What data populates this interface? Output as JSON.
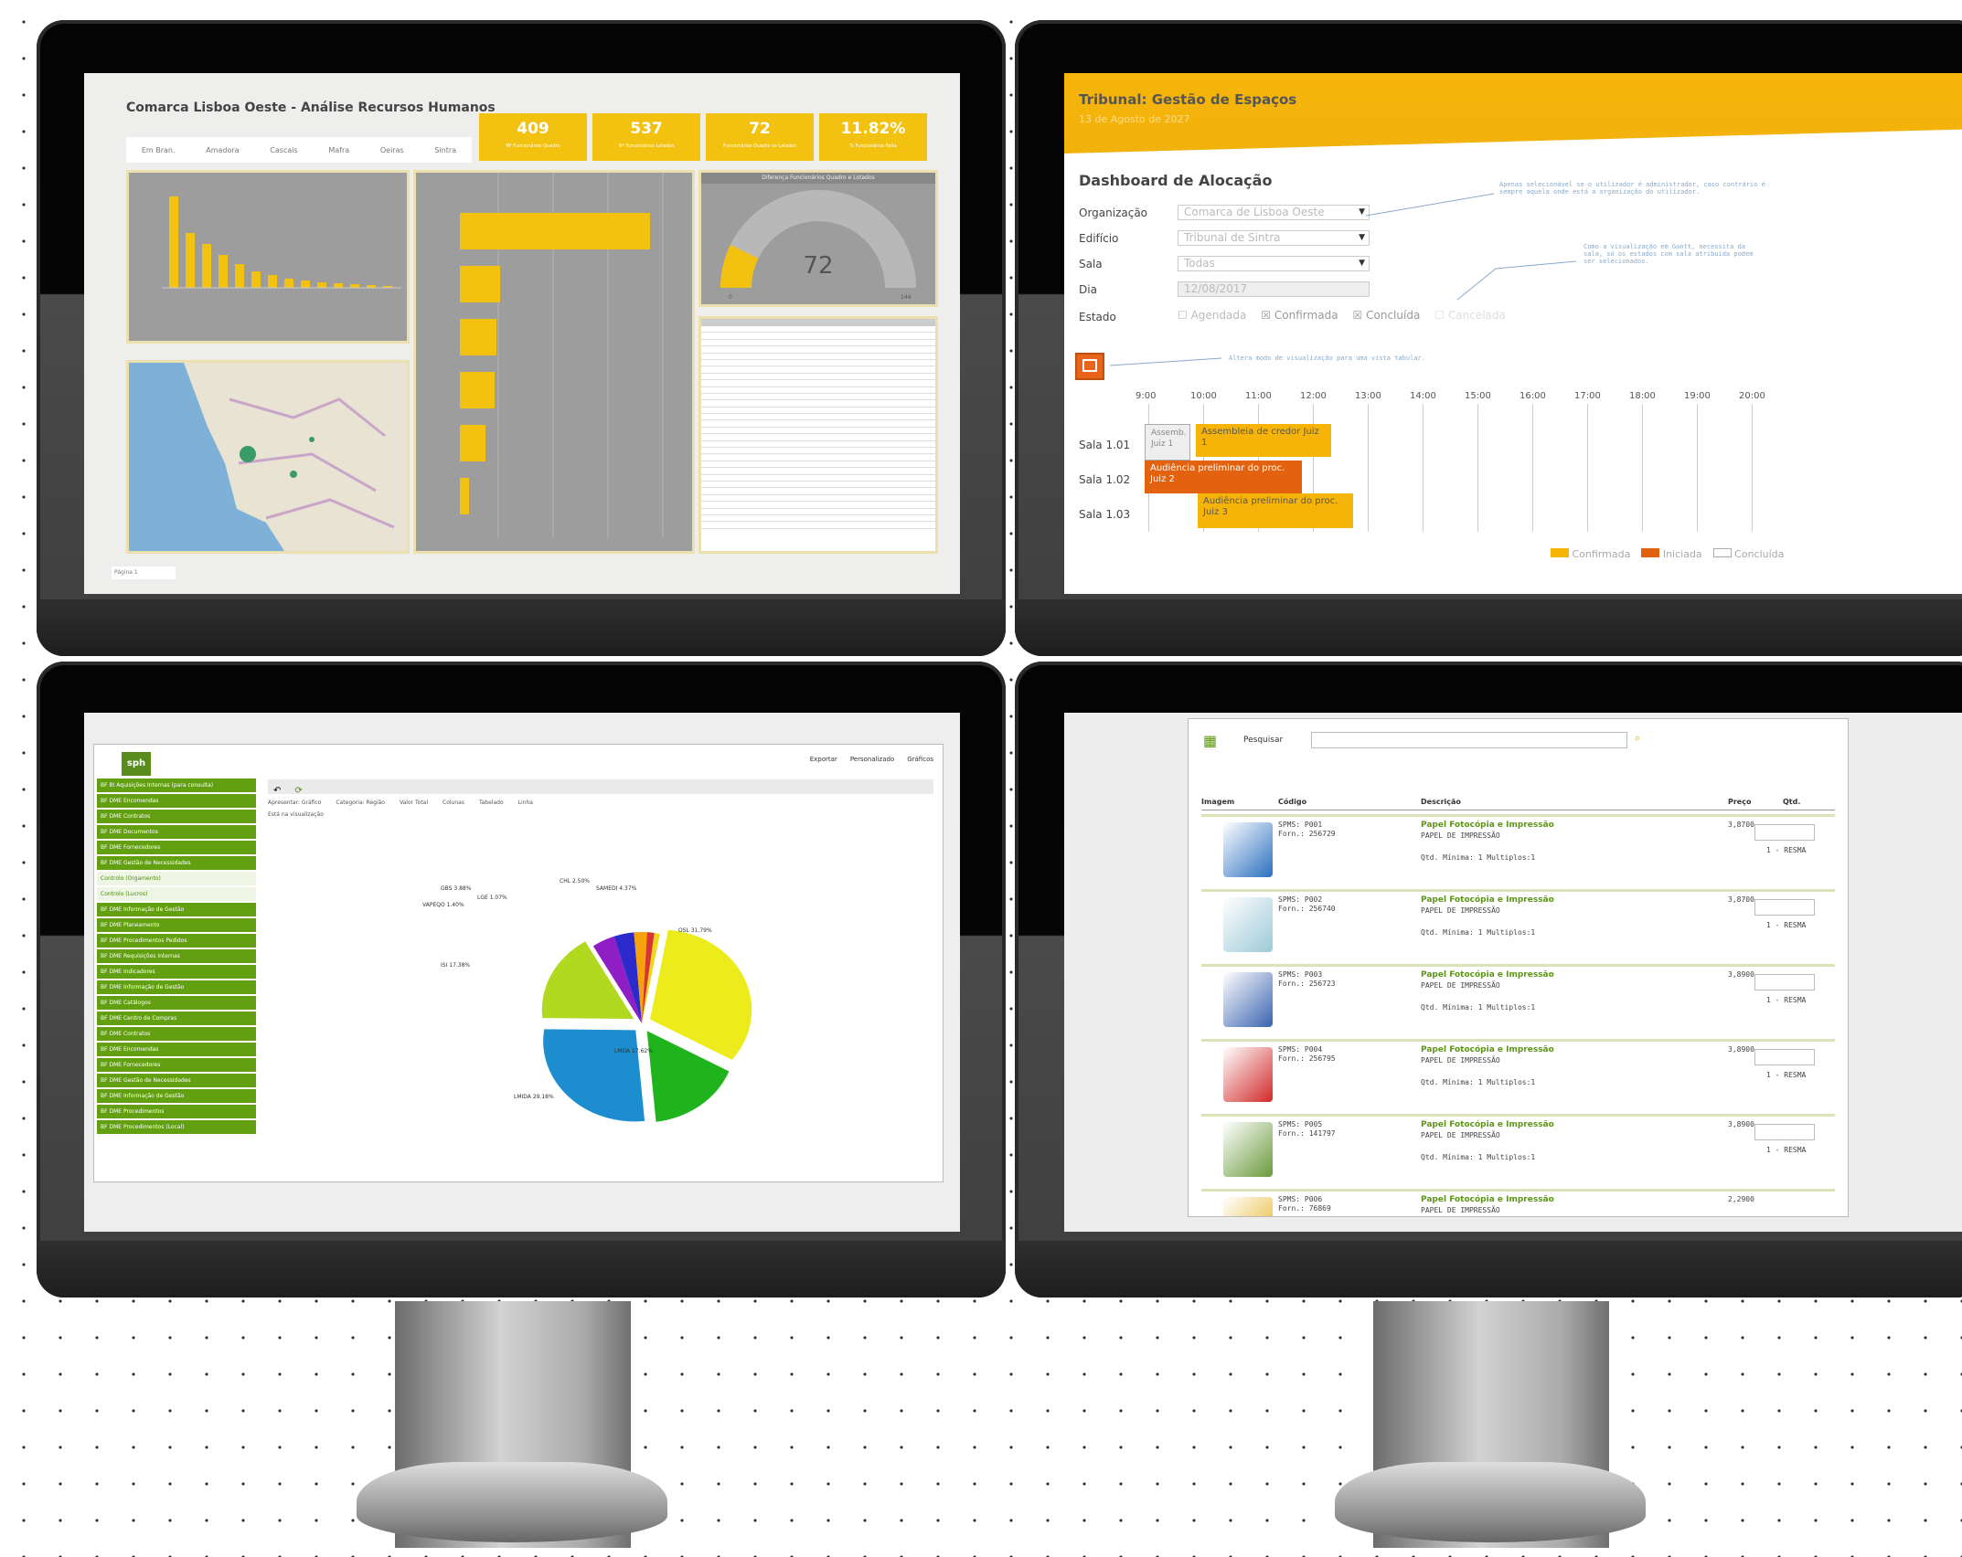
{
  "s1": {
    "title": "Comarca Lisboa Oeste - Análise Recursos Humanos",
    "tabs": [
      "Em Bran.",
      "Amadora",
      "Cascais",
      "Mafra",
      "Oeiras",
      "Sintra"
    ],
    "kpis": [
      {
        "value": "409",
        "label": "Nº Funcionários Quadro"
      },
      {
        "value": "537",
        "label": "Nº Funcionários Lotados"
      },
      {
        "value": "72",
        "label": "Funcionários Quadro vs Lotados"
      },
      {
        "value": "11.82%",
        "label": "% Funcionários Falta"
      }
    ],
    "gauge_title": "Diferença Funcionários Quadro e Lotados",
    "gauge_value": "72",
    "gauge_min": "0",
    "gauge_max": "144",
    "pct_values": [
      0.58,
      0.72
    ],
    "page_tab": "Página 1"
  },
  "s2": {
    "title": "Tribunal: Gestão de Espaços",
    "date": "13 de Agosto de 2027",
    "section": "Dashboard de Alocação",
    "fields": [
      {
        "label": "Organização",
        "value": "Comarca de Lisboa Oeste"
      },
      {
        "label": "Edifício",
        "value": "Tribunal de Sintra"
      },
      {
        "label": "Sala",
        "value": "Todas"
      },
      {
        "label": "Dia",
        "value": "12/08/2017"
      }
    ],
    "estado_label": "Estado",
    "estados": [
      "Agendada",
      "Confirmada",
      "Concluída",
      "Cancelada"
    ],
    "note1": "Apenas selecionável se o utilizador é administrador, caso contrário é sempre aquela onde está a organização do utilizador.",
    "note2": "Como a visualização em Gantt, necessita da sala, só os estados com sala atribuída podem ser selecionados.",
    "note3": "Altera modo de visualização para uma vista tabular.",
    "hours": [
      "9:00",
      "10:00",
      "11:00",
      "12:00",
      "13:00",
      "14:00",
      "15:00",
      "16:00",
      "17:00",
      "18:00",
      "19:00",
      "20:00"
    ],
    "rooms": [
      "Sala 1.01",
      "Sala 1.02",
      "Sala 1.03"
    ],
    "bars": [
      {
        "text": "Assemb. Juiz 1"
      },
      {
        "text": "Assembleia de credor Juiz 1"
      },
      {
        "text": "Audiência preliminar do proc. Juiz 2"
      },
      {
        "text": "Audiência preliminar do proc. Juiz 3"
      }
    ],
    "legend": [
      "Confirmada",
      "Iniciada",
      "Concluída"
    ],
    "colors": {
      "confirmed": "#f5b407",
      "started": "#e2620f"
    }
  },
  "s3": {
    "logo": "sph",
    "toolbar": [
      "Exportar",
      "Personalizado",
      "Gráficos"
    ],
    "menu": [
      "BF BI Aquisições Internas (para consulta)",
      "BF DME Encomendas",
      "BF DME Contratos",
      "BF DME Documentos",
      "BF DME Fornecedores",
      "BF DME Gestão de Necessidades",
      "Controlo (Orgamento)",
      "Controlo (Lucros)",
      "BF DME Informação de Gestão",
      "BF DME Planeamento",
      "BF DME Procedimentos Pedidos",
      "BF DME Requisições Internas",
      "BF DME Indicadores",
      "BF DME Informação de Gestão",
      "BF DME Catálogos",
      "BF DME Centro de Compras",
      "BF DME Contratos",
      "BF DME Encomendas",
      "BF DME Fornecedores",
      "BF DME Gestão de Necessidades",
      "BF DME Informação de Gestão",
      "BF DME Procedimentos",
      "BF DME Procedimentos (Local)"
    ],
    "filters": [
      "Apresentar: Gráfico",
      "Categoria: Região",
      "Valor Total",
      "Colunas",
      "Tabelado",
      "Linha"
    ],
    "filter_note": "Está na visualização",
    "pie_labels": [
      "CHL 2.50%",
      "SAMEDI 4.37%",
      "OSL 31.79%",
      "LMDA 17.62%",
      "LMIDA 29.18%",
      "ISI 17.38%",
      "GBS 3.88%",
      "VAPEQO 1.40%",
      "LGE 1.07%"
    ],
    "chart_data": {
      "type": "pie",
      "slices": [
        {
          "label": "OSL",
          "value": 31.79
        },
        {
          "label": "LMIDA",
          "value": 29.18
        },
        {
          "label": "ISI",
          "value": 17.38
        },
        {
          "label": "LMDA",
          "value": 17.62
        },
        {
          "label": "SAMEDI",
          "value": 4.37
        },
        {
          "label": "GBS",
          "value": 3.88
        },
        {
          "label": "CHL",
          "value": 2.5
        },
        {
          "label": "VAPEQO",
          "value": 1.4
        },
        {
          "label": "LGE",
          "value": 1.07
        }
      ]
    }
  },
  "s4": {
    "search_label": "Pesquisar",
    "cols": [
      "Imagem",
      "Código",
      "Descrição",
      "Preço",
      "Qtd."
    ],
    "rows": [
      {
        "code": "SPMS: P001\nForn.: 256729",
        "title": "Papel Fotocópia e Impressão",
        "sub": "PAPEL DE IMPRESSÃO",
        "min": "Qtd. Mínima: 1 Multiplos:1",
        "price": "3,8700",
        "unit": "1 - RESMA",
        "img": "#2a6fc0"
      },
      {
        "code": "SPMS: P002\nForn.: 256740",
        "title": "Papel Fotocópia e Impressão",
        "sub": "PAPEL DE IMPRESSÃO",
        "min": "Qtd. Mínima: 1 Multiplos:1",
        "price": "3,8700",
        "unit": "1 - RESMA",
        "img": "#9cc9d8"
      },
      {
        "code": "SPMS: P003\nForn.: 256723",
        "title": "Papel Fotocópia e Impressão",
        "sub": "PAPEL DE IMPRESSÃO",
        "min": "Qtd. Mínima: 1 Multiplos:1",
        "price": "3,8900",
        "unit": "1 - RESMA",
        "img": "#3b62b0"
      },
      {
        "code": "SPMS: P004\nForn.: 256795",
        "title": "Papel Fotocópia e Impressão",
        "sub": "PAPEL DE IMPRESSÃO",
        "min": "Qtd. Mínima: 1 Multiplos:1",
        "price": "3,8900",
        "unit": "1 - RESMA",
        "img": "#d22a2a"
      },
      {
        "code": "SPMS: P005\nForn.: 141797",
        "title": "Papel Fotocópia e Impressão",
        "sub": "PAPEL DE IMPRESSÃO",
        "min": "Qtd. Mínima: 1 Multiplos:1",
        "price": "3,8900",
        "unit": "1 - RESMA",
        "img": "#6a9a3c"
      },
      {
        "code": "SPMS: P006\nForn.: 76869",
        "title": "Papel Fotocópia e Impressão",
        "sub": "PAPEL DE IMPRESSÃO",
        "min": "",
        "price": "2,2900",
        "unit": "",
        "img": "#e6b21f"
      }
    ]
  }
}
